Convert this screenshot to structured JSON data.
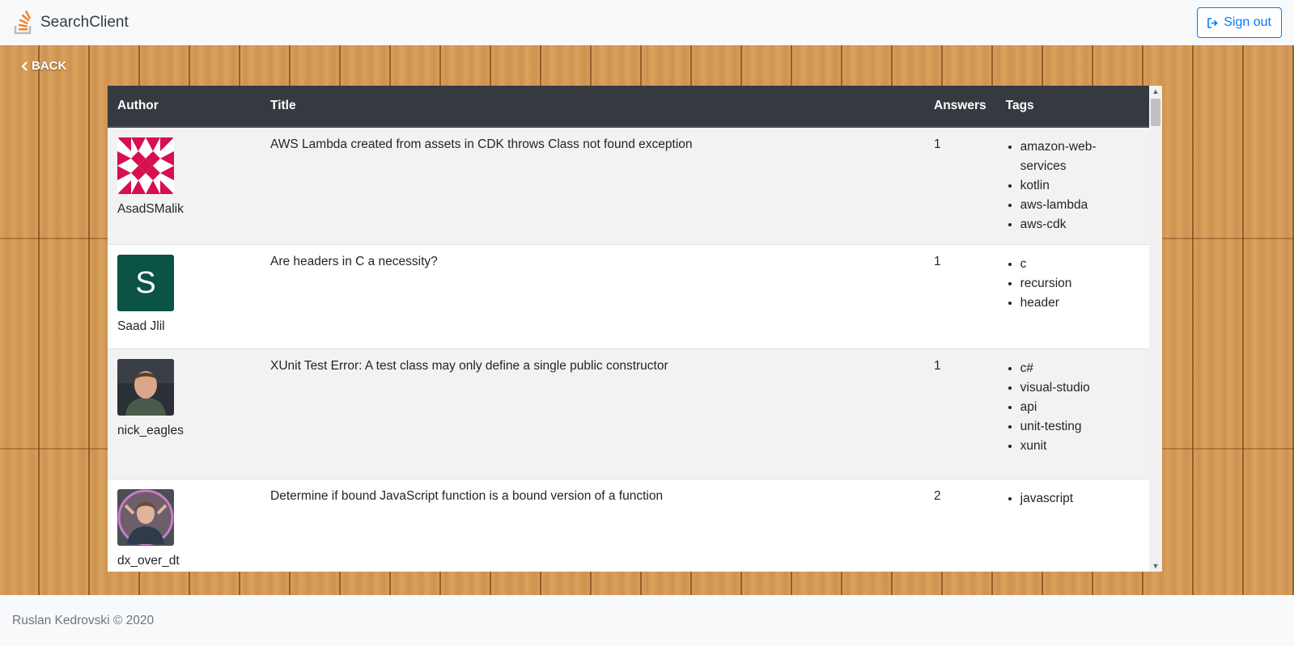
{
  "navbar": {
    "brand": "SearchClient",
    "signout_label": "Sign out"
  },
  "back_label": "BACK",
  "table": {
    "headers": [
      "Author",
      "Title",
      "Answers",
      "Tags"
    ],
    "rows": [
      {
        "author": "AsadSMalik",
        "avatar": "identicon-pink",
        "title": "AWS Lambda created from assets in CDK throws Class not found exception",
        "answers": "1",
        "tags": [
          "amazon-web-services",
          "kotlin",
          "aws-lambda",
          "aws-cdk"
        ]
      },
      {
        "author": "Saad Jlil",
        "avatar": "letter-s",
        "avatar_letter": "S",
        "title": "Are headers in C a necessity?",
        "answers": "1",
        "tags": [
          "c",
          "recursion",
          "header"
        ]
      },
      {
        "author": "nick_eagles",
        "avatar": "photo-man",
        "title": "XUnit Test Error: A test class may only define a single public constructor",
        "answers": "1",
        "tags": [
          "c#",
          "visual-studio",
          "api",
          "unit-testing",
          "xunit"
        ]
      },
      {
        "author": "dx_over_dt",
        "avatar": "photo-woman",
        "title": "Determine if bound JavaScript function is a bound version of a function",
        "answers": "2",
        "tags": [
          "javascript"
        ]
      }
    ]
  },
  "footer": {
    "text": "Ruslan Kedrovski © 2020"
  },
  "colors": {
    "navbar_bg": "#f8f9fa",
    "table_header_bg": "#343a40",
    "accent": "#007bff",
    "brand_icon": "#f48024",
    "identicon": "#d6104e",
    "letter_avatar": "#0b5345"
  }
}
